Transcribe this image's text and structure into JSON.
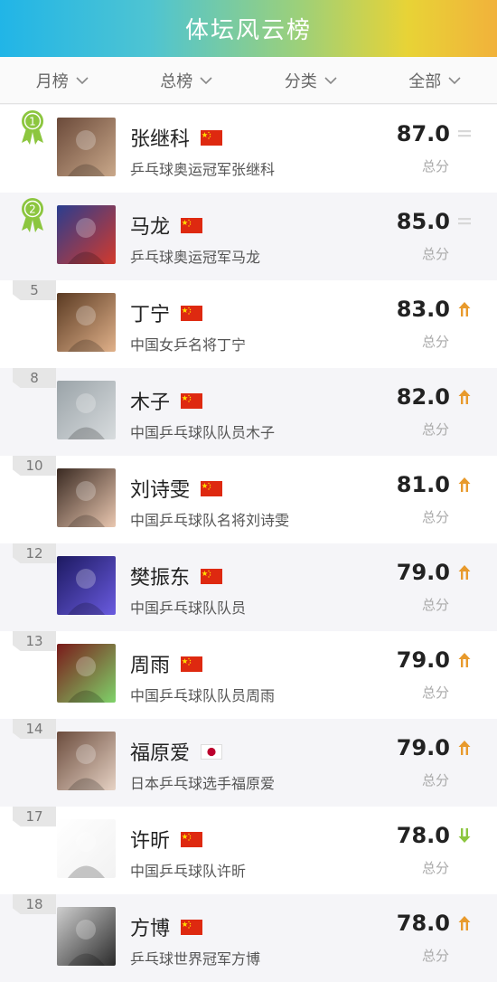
{
  "header": {
    "title": "体坛风云榜"
  },
  "filters": [
    {
      "label": "月榜"
    },
    {
      "label": "总榜"
    },
    {
      "label": "分类"
    },
    {
      "label": "全部"
    }
  ],
  "score_label": "总分",
  "entries": [
    {
      "rank_display": "1",
      "rank_type": "medal",
      "medal_color": "#8cc63f",
      "name": "张继科",
      "flag": "cn",
      "desc": "乒乓球奥运冠军张继科",
      "score": "87.0",
      "trend": "same",
      "avatar_colors": [
        "#6b4a3a",
        "#c9a88a"
      ]
    },
    {
      "rank_display": "2",
      "rank_type": "medal",
      "medal_color": "#8cc63f",
      "name": "马龙",
      "flag": "cn",
      "desc": "乒乓球奥运冠军马龙",
      "score": "85.0",
      "trend": "same",
      "avatar_colors": [
        "#2a3d8f",
        "#d33a2c"
      ]
    },
    {
      "rank_display": "5",
      "rank_type": "tab",
      "name": "丁宁",
      "flag": "cn",
      "desc": "中国女乒名将丁宁",
      "score": "83.0",
      "trend": "up",
      "avatar_colors": [
        "#5a3a22",
        "#e0b18a"
      ]
    },
    {
      "rank_display": "8",
      "rank_type": "tab",
      "name": "木子",
      "flag": "cn",
      "desc": "中国乒乓球队队员木子",
      "score": "82.0",
      "trend": "up",
      "avatar_colors": [
        "#9aa3a8",
        "#d8dcde"
      ]
    },
    {
      "rank_display": "10",
      "rank_type": "tab",
      "name": "刘诗雯",
      "flag": "cn",
      "desc": "中国乒乓球队名将刘诗雯",
      "score": "81.0",
      "trend": "up",
      "avatar_colors": [
        "#3a2a22",
        "#e9c7b0"
      ]
    },
    {
      "rank_display": "12",
      "rank_type": "tab",
      "name": "樊振东",
      "flag": "cn",
      "desc": "中国乒乓球队队员",
      "score": "79.0",
      "trend": "up",
      "avatar_colors": [
        "#1c1960",
        "#6a5be0"
      ]
    },
    {
      "rank_display": "13",
      "rank_type": "tab",
      "name": "周雨",
      "flag": "cn",
      "desc": "中国乒乓球队队员周雨",
      "score": "79.0",
      "trend": "up",
      "avatar_colors": [
        "#7a1a1a",
        "#7fd36a"
      ]
    },
    {
      "rank_display": "14",
      "rank_type": "tab",
      "name": "福原爱",
      "flag": "jp",
      "desc": "日本乒乓球选手福原爱",
      "score": "79.0",
      "trend": "up",
      "avatar_colors": [
        "#6b4c3d",
        "#e6d2c4"
      ]
    },
    {
      "rank_display": "17",
      "rank_type": "tab",
      "name": "许昕",
      "flag": "cn",
      "desc": "中国乒乓球队许昕",
      "score": "78.0",
      "trend": "down",
      "avatar_colors": [
        "#ffffff",
        "#f2f2f2"
      ]
    },
    {
      "rank_display": "18",
      "rank_type": "tab",
      "name": "方博",
      "flag": "cn",
      "desc": "乒乓球世界冠军方博",
      "score": "78.0",
      "trend": "up",
      "avatar_colors": [
        "#cfcfcf",
        "#2a2a2a"
      ]
    }
  ],
  "colors": {
    "trend_up": "#e89a2c",
    "trend_down": "#8cc63f",
    "trend_same": "#d8d8d8",
    "cn_flag": "#de2910",
    "cn_star": "#ffde00",
    "jp_sun": "#bc002d"
  }
}
